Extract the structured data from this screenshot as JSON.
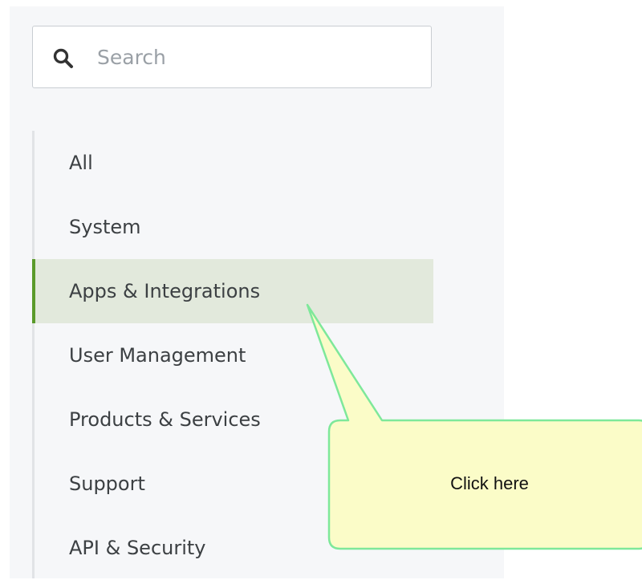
{
  "search": {
    "placeholder": "Search",
    "value": ""
  },
  "nav": {
    "items": [
      {
        "label": "All",
        "active": false
      },
      {
        "label": "System",
        "active": false
      },
      {
        "label": "Apps & Integrations",
        "active": true
      },
      {
        "label": "User Management",
        "active": false
      },
      {
        "label": "Products & Services",
        "active": false
      },
      {
        "label": "Support",
        "active": false
      },
      {
        "label": "API & Security",
        "active": false
      }
    ]
  },
  "callout": {
    "text": "Click here"
  },
  "colors": {
    "active_bg": "#e2e9dc",
    "active_indicator": "#5a9a2a",
    "callout_fill": "#fbfcc8",
    "callout_border": "#7ee89a"
  }
}
